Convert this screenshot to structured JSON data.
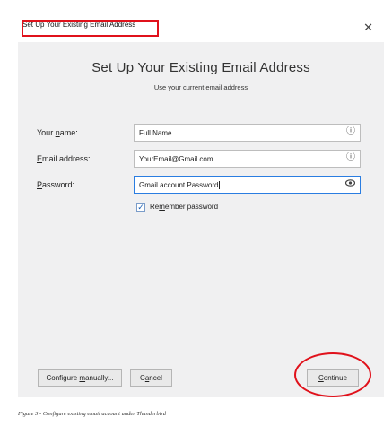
{
  "window": {
    "title": "Set Up Your Existing Email Address",
    "close_icon": "close-icon"
  },
  "header": {
    "title": "Set Up Your Existing Email Address",
    "subtitle": "Use your current email address"
  },
  "form": {
    "name": {
      "label_pre": "Your ",
      "label_key": "n",
      "label_post": "ame:",
      "value": "Full Name",
      "icon": "info-icon"
    },
    "email": {
      "label_pre": "",
      "label_key": "E",
      "label_post": "mail address:",
      "value": "YourEmail@Gmail.com",
      "icon": "info-icon"
    },
    "password": {
      "label_pre": "",
      "label_key": "P",
      "label_post": "assword:",
      "value": "Gmail account Password",
      "icon": "eye-icon"
    },
    "remember": {
      "checked": true,
      "label_pre": "Re",
      "label_key": "m",
      "label_post": "ember password"
    }
  },
  "buttons": {
    "configure": {
      "pre": "Configure ",
      "key": "m",
      "post": "anually..."
    },
    "cancel": {
      "pre": "C",
      "key": "a",
      "post": "ncel"
    },
    "continue": {
      "pre": "",
      "key": "C",
      "post": "ontinue"
    }
  },
  "annotations": {
    "highlight_color": "#e0111b"
  },
  "caption": "Figure 3 - Configure existing email account under Thunderbird"
}
